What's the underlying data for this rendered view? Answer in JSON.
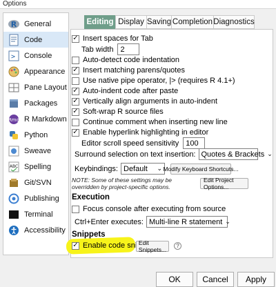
{
  "window": {
    "title": "Options"
  },
  "sidebar": {
    "items": [
      {
        "label": "General",
        "icon": "r-logo-icon"
      },
      {
        "label": "Code",
        "icon": "code-document-icon",
        "active": true
      },
      {
        "label": "Console",
        "icon": "console-icon"
      },
      {
        "label": "Appearance",
        "icon": "appearance-icon"
      },
      {
        "label": "Pane Layout",
        "icon": "pane-layout-icon"
      },
      {
        "label": "Packages",
        "icon": "packages-icon"
      },
      {
        "label": "R Markdown",
        "icon": "rmarkdown-icon"
      },
      {
        "label": "Python",
        "icon": "python-icon"
      },
      {
        "label": "Sweave",
        "icon": "sweave-icon"
      },
      {
        "label": "Spelling",
        "icon": "spelling-icon"
      },
      {
        "label": "Git/SVN",
        "icon": "git-icon"
      },
      {
        "label": "Publishing",
        "icon": "publishing-icon"
      },
      {
        "label": "Terminal",
        "icon": "terminal-icon"
      },
      {
        "label": "Accessibility",
        "icon": "accessibility-icon"
      }
    ]
  },
  "tabs": [
    {
      "label": "Editing",
      "active": true
    },
    {
      "label": "Display"
    },
    {
      "label": "Saving"
    },
    {
      "label": "Completion"
    },
    {
      "label": "Diagnostics"
    }
  ],
  "editing": {
    "insert_spaces": {
      "label": "Insert spaces for Tab",
      "checked": true
    },
    "tab_width_label": "Tab width",
    "tab_width_value": "2",
    "auto_detect": {
      "label": "Auto-detect code indentation",
      "checked": false
    },
    "matching_parens": {
      "label": "Insert matching parens/quotes",
      "checked": true
    },
    "native_pipe": {
      "label": "Use native pipe operator, |> (requires R 4.1+)",
      "checked": false
    },
    "auto_indent": {
      "label": "Auto-indent code after paste",
      "checked": true
    },
    "vertically_align": {
      "label": "Vertically align arguments in auto-indent",
      "checked": true
    },
    "soft_wrap": {
      "label": "Soft-wrap R source files",
      "checked": true
    },
    "continue_comment": {
      "label": "Continue comment when inserting new line",
      "checked": false
    },
    "hyperlink": {
      "label": "Enable hyperlink highlighting in editor",
      "checked": true
    },
    "scroll_speed_label": "Editor scroll speed sensitivity",
    "scroll_speed_value": "100",
    "surround_label": "Surround selection on text insertion:",
    "surround_value": "Quotes & Brackets",
    "keybindings_label": "Keybindings:",
    "keybindings_value": "Default",
    "modify_shortcuts": "Modify Keyboard Shortcuts...",
    "note": "NOTE: Some of these settings may be overridden by project-specific options.",
    "edit_project_options": "Edit Project Options..."
  },
  "execution": {
    "title": "Execution",
    "focus_console": {
      "label": "Focus console after executing from source",
      "checked": false
    },
    "ctrl_enter_label": "Ctrl+Enter executes:",
    "ctrl_enter_value": "Multi-line R statement"
  },
  "snippets": {
    "title": "Snippets",
    "enable": {
      "label": "Enable code snippets",
      "checked": true
    },
    "edit_button": "Edit Snippets...",
    "help": "?",
    "highlight_color": "#f7f31a"
  },
  "footer": {
    "ok": "OK",
    "cancel": "Cancel",
    "apply": "Apply"
  },
  "colors": {
    "active_tab": "#6f9e8a",
    "sidebar_active": "#d9e8f7"
  }
}
